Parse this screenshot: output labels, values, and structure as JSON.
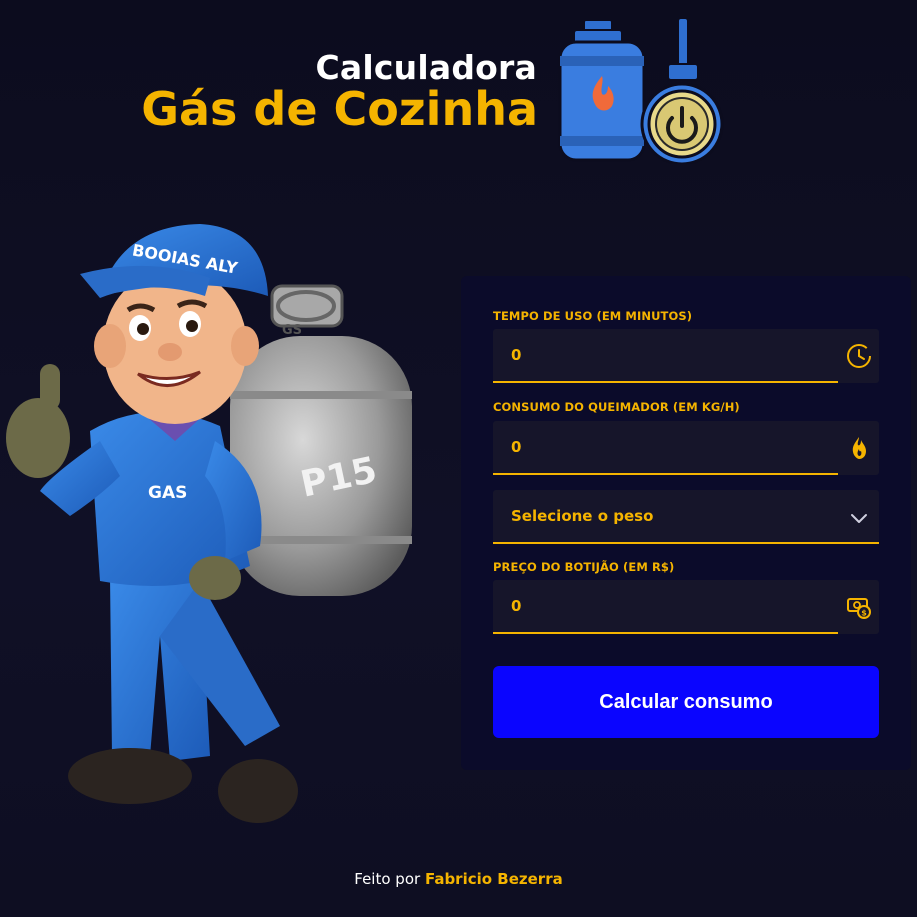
{
  "header": {
    "title_top": "Calculadora",
    "title_main": "Gás de Cozinha",
    "logo_icon": "gas-cylinder-and-stove-knob-icon"
  },
  "mascot": {
    "cap_text": "BOOIAS ALY",
    "shirt_text": "GAS",
    "cylinder_text": "P15",
    "cylinder_cap_text": "GS"
  },
  "form": {
    "tempo": {
      "label": "TEMPO DE USO (EM MINUTOS)",
      "value": "0",
      "icon": "clock-icon"
    },
    "consumo": {
      "label": "CONSUMO DO QUEIMADOR (EM KG/H)",
      "value": "0",
      "icon": "flame-icon"
    },
    "peso": {
      "selected": "Selecione o peso",
      "icon": "chevron-down-icon"
    },
    "preco": {
      "label": "PREÇO DO BOTIJÃO (EM R$)",
      "value": "0",
      "icon": "money-icon"
    },
    "button_label": "Calcular consumo"
  },
  "footer": {
    "prefix": "Feito por",
    "author": "Fabricio Bezerra"
  },
  "colors": {
    "accent": "#f5b400",
    "button": "#0a05ff",
    "background": "#0c0c1e",
    "card": "#0b0b2a",
    "field": "#16152a"
  }
}
